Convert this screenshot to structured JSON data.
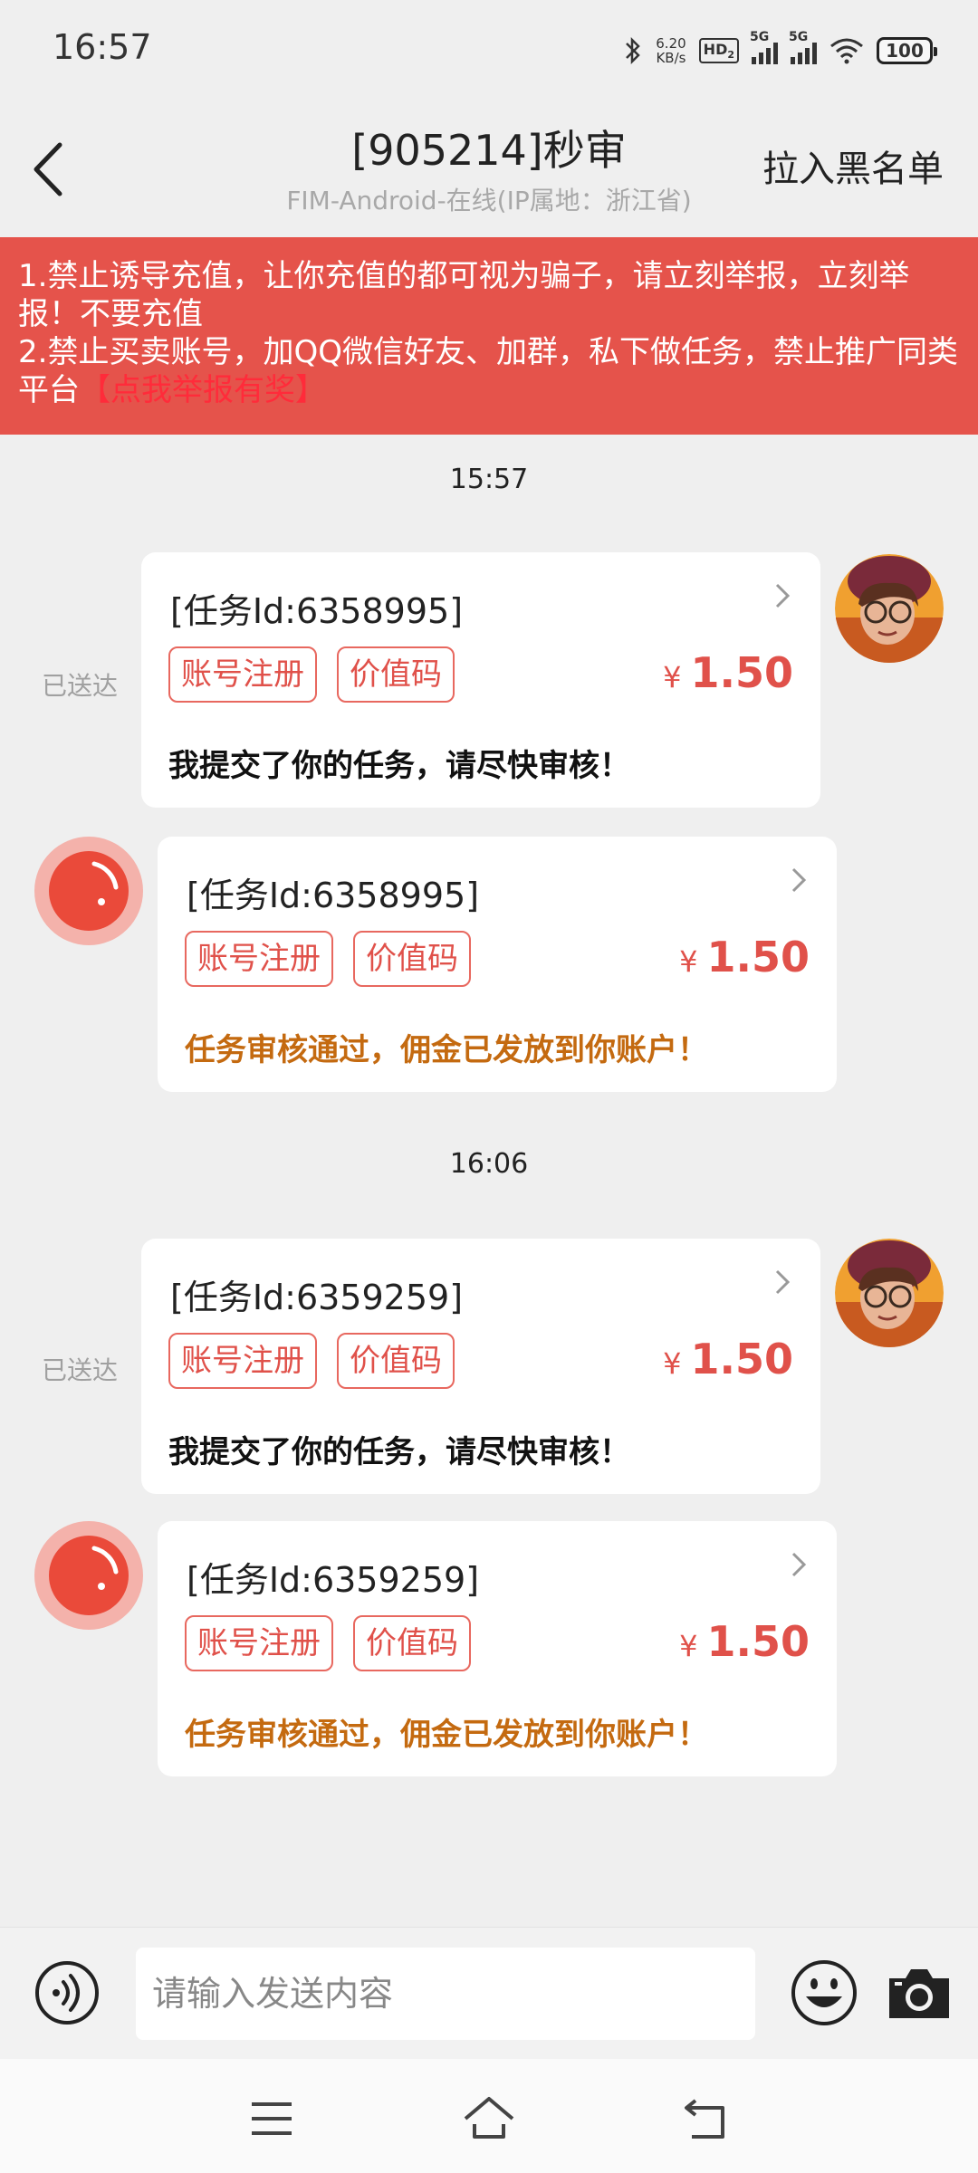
{
  "status_bar": {
    "time": "16:57",
    "net_speed_value": "6.20",
    "net_speed_unit": "KB/s",
    "hd_label": "HD",
    "hd_sub": "2",
    "sim1": "5G",
    "sim2": "5G",
    "battery": "100"
  },
  "header": {
    "title": "[905214]秒审",
    "subtitle": "FIM-Android-在线(IP属地：浙江省)",
    "blacklist_label": "拉入黑名单"
  },
  "warning": {
    "line1": "1.禁止诱导充值，让你充值的都可视为骗子，请立刻举报，立刻举报！不要充值",
    "line2": "2.禁止买卖账号，加QQ微信好友、加群，私下做任务，禁止推广同类平台",
    "report_link": "【点我举报有奖】"
  },
  "conversation": [
    {
      "time": "15:57",
      "sent": {
        "task_id": "[任务Id:6358995]",
        "tags": [
          "账号注册",
          "价值码"
        ],
        "currency": "¥",
        "price": "1.50",
        "message": "我提交了你的任务，请尽快审核！",
        "status": "已送达"
      },
      "received": {
        "task_id": "[任务Id:6358995]",
        "tags": [
          "账号注册",
          "价值码"
        ],
        "currency": "¥",
        "price": "1.50",
        "message": "任务审核通过，佣金已发放到你账户！"
      }
    },
    {
      "time": "16:06",
      "sent": {
        "task_id": "[任务Id:6359259]",
        "tags": [
          "账号注册",
          "价值码"
        ],
        "currency": "¥",
        "price": "1.50",
        "message": "我提交了你的任务，请尽快审核！",
        "status": "已送达"
      },
      "received": {
        "task_id": "[任务Id:6359259]",
        "tags": [
          "账号注册",
          "价值码"
        ],
        "currency": "¥",
        "price": "1.50",
        "message": "任务审核通过，佣金已发放到你账户！"
      }
    }
  ],
  "input": {
    "placeholder": "请输入发送内容"
  },
  "icons": {
    "back": "back-arrow-icon",
    "chevron": "chevron-right-icon",
    "voice": "voice-icon",
    "emoji": "emoji-icon",
    "camera": "camera-icon",
    "nav_menu": "menu-icon",
    "nav_home": "home-icon",
    "nav_back": "back-icon"
  },
  "colors": {
    "warning_bg": "#e5534b",
    "accent_red": "#e0514a",
    "approved_text": "#c46a10"
  }
}
